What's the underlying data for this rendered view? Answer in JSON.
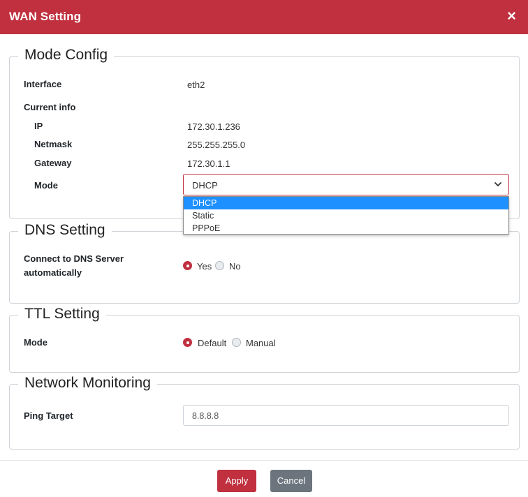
{
  "dialog": {
    "title": "WAN Setting",
    "close_glyph": "×"
  },
  "mode_config": {
    "legend": "Mode Config",
    "interface_label": "Interface",
    "interface_value": "eth2",
    "current_info_label": "Current info",
    "ip_label": "IP",
    "ip_value": "172.30.1.236",
    "netmask_label": "Netmask",
    "netmask_value": "255.255.255.0",
    "gateway_label": "Gateway",
    "gateway_value": "172.30.1.1",
    "mode_label": "Mode",
    "mode_selected": "DHCP",
    "mode_options": [
      "DHCP",
      "Static",
      "PPPoE"
    ]
  },
  "dns_setting": {
    "legend": "DNS Setting",
    "connect_label_line1": "Connect to DNS Server",
    "connect_label_line2": "automatically",
    "options": [
      "Yes",
      "No"
    ],
    "selected": "Yes"
  },
  "ttl_setting": {
    "legend": "TTL Setting",
    "mode_label": "Mode",
    "options": [
      "Default",
      "Manual"
    ],
    "selected": "Default"
  },
  "network_monitoring": {
    "legend": "Network Monitoring",
    "ping_label": "Ping Target",
    "ping_value": "8.8.8.8"
  },
  "footer": {
    "apply_label": "Apply",
    "cancel_label": "Cancel"
  },
  "colors": {
    "accent": "#c0303f",
    "secondary": "#6c757d",
    "highlight": "#1e90ff"
  },
  "icons": {
    "close": "close-icon",
    "select_arrow": "chevron-down-icon"
  }
}
